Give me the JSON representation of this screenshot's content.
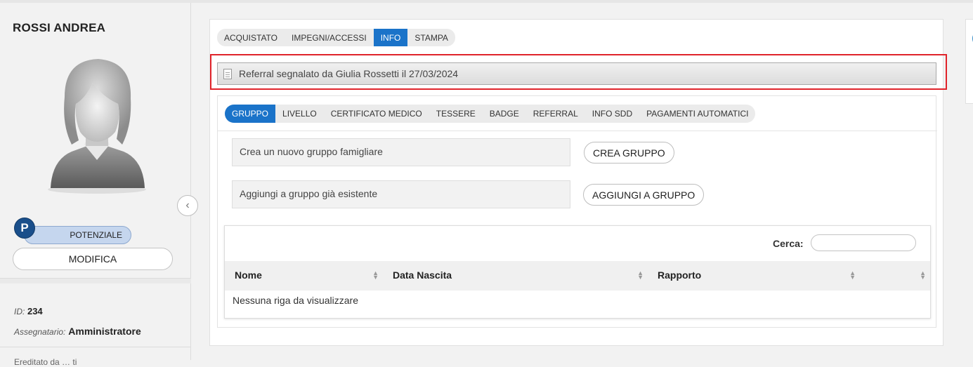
{
  "sidebar": {
    "name": "ROSSI ANDREA",
    "status_initial": "P",
    "status_label": "POTENZIALE",
    "edit_label": "MODIFICA",
    "id_label": "ID:",
    "id_value": "234",
    "assignee_label": "Assegnatario:",
    "assignee_value": "Amministratore",
    "cut_text": "Ereditato da … ti"
  },
  "top_tabs": [
    {
      "label": "ACQUISTATO",
      "active": false
    },
    {
      "label": "IMPEGNI/ACCESSI",
      "active": false
    },
    {
      "label": "INFO",
      "active": true
    },
    {
      "label": "STAMPA",
      "active": false
    }
  ],
  "referral_text": "Referral segnalato da Giulia Rossetti il 27/03/2024",
  "sub_tabs": [
    {
      "label": "GRUPPO",
      "active": true
    },
    {
      "label": "LIVELLO",
      "active": false
    },
    {
      "label": "CERTIFICATO MEDICO",
      "active": false
    },
    {
      "label": "TESSERE",
      "active": false
    },
    {
      "label": "BADGE",
      "active": false
    },
    {
      "label": "REFERRAL",
      "active": false
    },
    {
      "label": "INFO SDD",
      "active": false
    },
    {
      "label": "PAGAMENTI AUTOMATICI",
      "active": false
    }
  ],
  "group": {
    "create_text": "Crea un nuovo gruppo famigliare",
    "create_button": "CREA GRUPPO",
    "add_text": "Aggiungi a gruppo già esistente",
    "add_button": "AGGIUNGI A GRUPPO"
  },
  "table": {
    "search_label": "Cerca:",
    "search_value": "",
    "columns": [
      "Nome",
      "Data Nascita",
      "Rapporto",
      ""
    ],
    "empty_text": "Nessuna riga da visualizzare"
  },
  "colors": {
    "accent": "#1a73c9",
    "highlight": "#e0242b",
    "status_badge": "#1a4f8b"
  }
}
